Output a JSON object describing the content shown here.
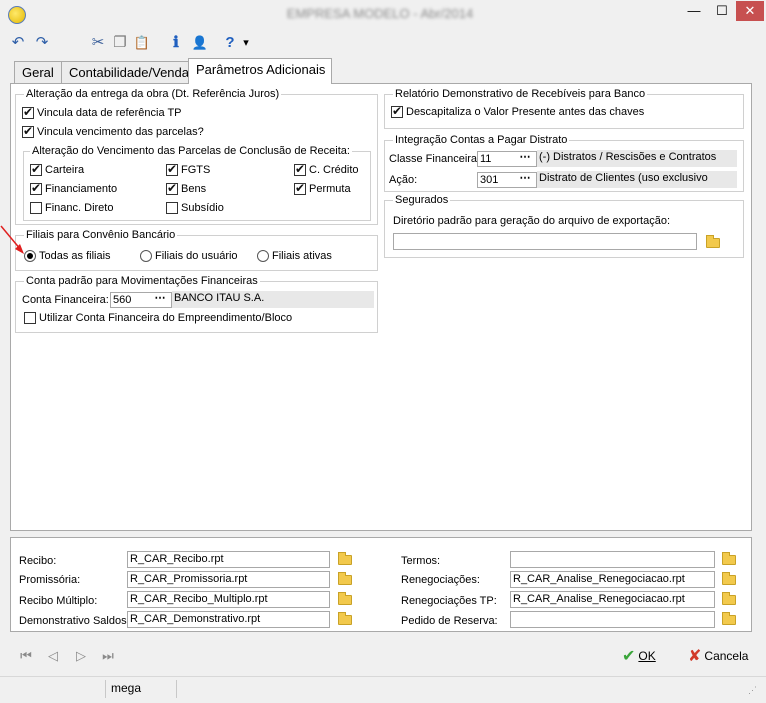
{
  "window": {
    "title": "EMPRESA MODELO - Abr/2014",
    "min_icon": "minimize-icon",
    "max_icon": "maximize-icon",
    "close_icon": "close-icon",
    "min_glyph": "—",
    "max_glyph": "☐",
    "close_glyph": "✕"
  },
  "toolbar": {
    "items": [
      {
        "icon": "undo-icon",
        "glyph": "↶"
      },
      {
        "icon": "redo-icon",
        "glyph": "↷"
      },
      {
        "icon": "cut-icon",
        "glyph": "✂"
      },
      {
        "icon": "copy-icon",
        "glyph": "❐"
      },
      {
        "icon": "paste-icon",
        "glyph": "📋"
      },
      {
        "icon": "info-icon",
        "glyph": "ℹ"
      },
      {
        "icon": "user-icon",
        "glyph": "👤"
      },
      {
        "icon": "help-icon",
        "glyph": "?"
      },
      {
        "icon": "dropdown-icon",
        "glyph": "▾"
      }
    ]
  },
  "tabs": [
    {
      "label": "Geral"
    },
    {
      "label": "Contabilidade/Venda"
    },
    {
      "label": "Parâmetros Adicionais",
      "active": true
    }
  ],
  "entrega": {
    "title": "Alteração da entrega da obra (Dt. Referência Juros)",
    "vincula_data": {
      "label": "Vincula data de referência TP",
      "checked": true
    },
    "vincula_venc": {
      "label": "Vincula vencimento das parcelas?",
      "checked": true
    },
    "vencimento": {
      "title": "Alteração do Vencimento das Parcelas de Conclusão de Receita:",
      "items": [
        {
          "label": "Carteira",
          "checked": true
        },
        {
          "label": "FGTS",
          "checked": true
        },
        {
          "label": "C. Crédito",
          "checked": true
        },
        {
          "label": "Financiamento",
          "checked": true
        },
        {
          "label": "Bens",
          "checked": true
        },
        {
          "label": "Permuta",
          "checked": true
        },
        {
          "label": "Financ. Direto",
          "checked": false
        },
        {
          "label": "Subsídio",
          "checked": false
        }
      ]
    }
  },
  "filiais": {
    "title": "Filiais para Convênio Bancário",
    "options": [
      {
        "label": "Todas as filiais",
        "selected": true
      },
      {
        "label": "Filiais do usuário",
        "selected": false
      },
      {
        "label": "Filiais ativas",
        "selected": false
      }
    ]
  },
  "conta_padrao": {
    "title": "Conta padrão para Movimentações Financeiras",
    "label": "Conta Financeira:",
    "code": "560",
    "name": "BANCO ITAU S.A.",
    "utilizar": {
      "label": "Utilizar Conta Financeira do Empreendimento/Bloco",
      "checked": false
    }
  },
  "relatorio": {
    "title": "Relatório Demonstrativo de Recebíveis para Banco",
    "descap": {
      "label": "Descapitaliza o Valor Presente antes das chaves",
      "checked": true
    }
  },
  "integracao": {
    "title": "Integração Contas a Pagar Distrato",
    "classe_label": "Classe Financeira:",
    "classe_code": "11",
    "classe_name": "(-) Distratos / Rescisões e Contratos",
    "acao_label": "Ação:",
    "acao_code": "301",
    "acao_name": "Distrato de Clientes (uso exclusivo"
  },
  "segurados": {
    "title": "Segurados",
    "dir_label": "Diretório padrão para geração do arquivo de exportação:",
    "dir_value": ""
  },
  "reports": {
    "left": [
      {
        "label": "Recibo:",
        "value": "R_CAR_Recibo.rpt"
      },
      {
        "label": "Promissória:",
        "value": "R_CAR_Promissoria.rpt"
      },
      {
        "label": "Recibo Múltiplo:",
        "value": "R_CAR_Recibo_Multiplo.rpt"
      },
      {
        "label": "Demonstrativo Saldos:",
        "value": "R_CAR_Demonstrativo.rpt"
      }
    ],
    "right": [
      {
        "label": "Termos:",
        "value": ""
      },
      {
        "label": "Renegociações:",
        "value": "R_CAR_Analise_Renegociacao.rpt"
      },
      {
        "label": "Renegociações TP:",
        "value": "R_CAR_Analise_Renegociacao.rpt"
      },
      {
        "label": "Pedido de Reserva:",
        "value": ""
      }
    ]
  },
  "nav": [
    {
      "icon": "first-record-icon",
      "glyph": "⏮"
    },
    {
      "icon": "previous-record-icon",
      "glyph": "◁"
    },
    {
      "icon": "next-record-icon",
      "glyph": "▷"
    },
    {
      "icon": "last-record-icon",
      "glyph": "⏭"
    }
  ],
  "buttons": {
    "ok": "OK",
    "ok_icon": "checkmark-icon",
    "ok_glyph": "✔",
    "cancel": "Cancela",
    "cancel_icon": "x-icon",
    "cancel_glyph": "✘"
  },
  "status": {
    "user": "mega"
  },
  "colors": {
    "ok_green": "#3aa53a",
    "cancel_red": "#d23a2a",
    "arrow_red": "#e02020",
    "folder_yellow": "#f2c94c"
  }
}
